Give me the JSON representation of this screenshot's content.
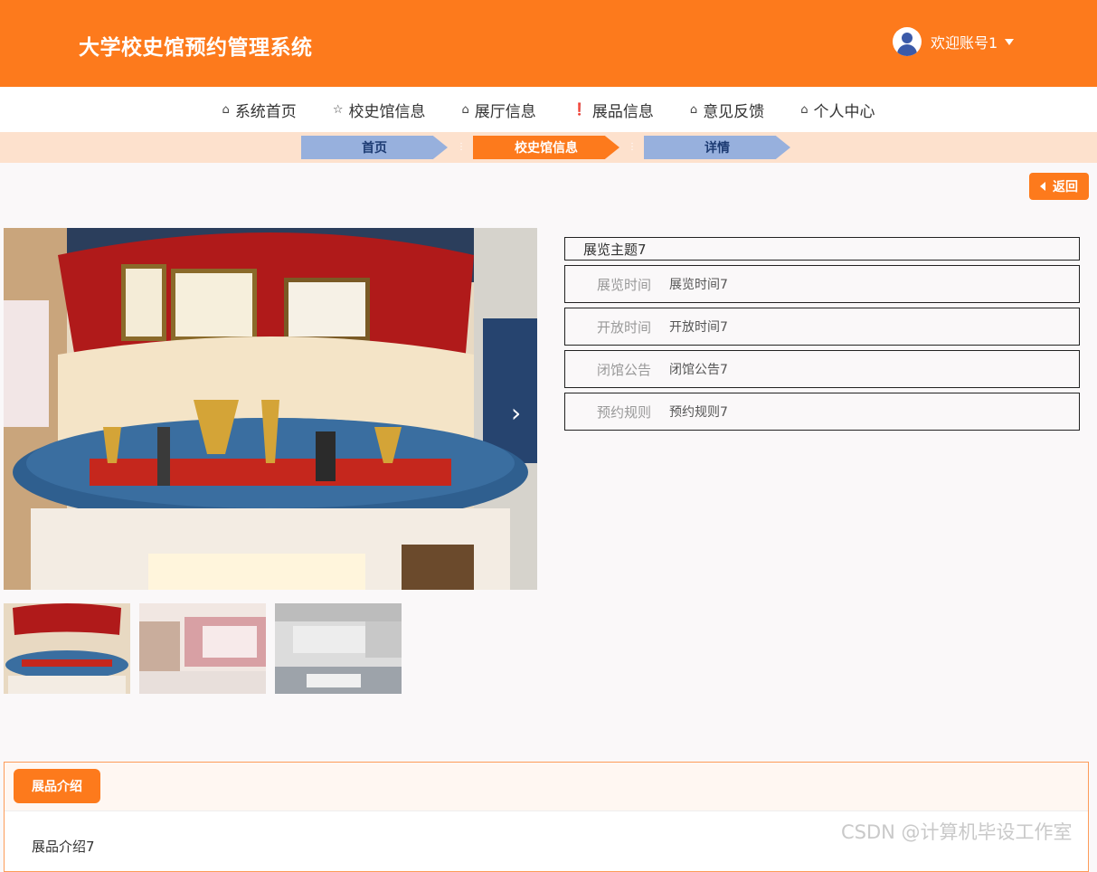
{
  "header": {
    "title": "大学校史馆预约管理系统",
    "user": "欢迎账号1"
  },
  "nav": [
    "系统首页",
    "校史馆信息",
    "展厅信息",
    "展品信息",
    "意见反馈",
    "个人中心"
  ],
  "breadcrumb": [
    "首页",
    "校史馆信息",
    "详情"
  ],
  "back_label": "返回",
  "detail": {
    "title": "展览主题7",
    "rows": [
      {
        "label": "展览时间",
        "value": "展览时间7"
      },
      {
        "label": "开放时间",
        "value": "开放时间7"
      },
      {
        "label": "闭馆公告",
        "value": "闭馆公告7"
      },
      {
        "label": "预约规则",
        "value": "预约规则7"
      }
    ]
  },
  "intro": {
    "tab": "展品介绍",
    "content": "展品介绍7"
  },
  "watermark": "CSDN @计算机毕设工作室"
}
